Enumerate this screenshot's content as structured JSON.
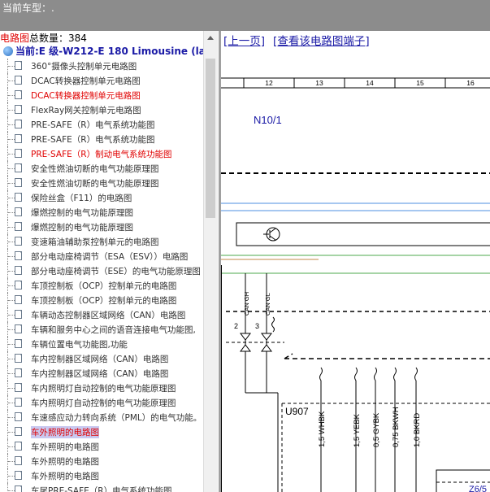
{
  "header": {
    "model_label": "当前车型：."
  },
  "sidebar": {
    "count_label": "电路图",
    "count_suffix": "总数量：384",
    "current_label": "当前:E 级-W212-E 180 Limousine (lan",
    "items": [
      {
        "label": "360°摄像头控制单元电路图",
        "state": "normal"
      },
      {
        "label": "DCAC转换器控制单元电路图",
        "state": "normal"
      },
      {
        "label": "DCAC转换器控制单元电路图",
        "state": "red"
      },
      {
        "label": "FlexRay网关控制单元电路图",
        "state": "normal"
      },
      {
        "label": "PRE-SAFE（R）电气系统功能图",
        "state": "normal"
      },
      {
        "label": "PRE-SAFE（R）电气系统功能图",
        "state": "normal"
      },
      {
        "label": "PRE-SAFE（R）制动电气系统功能图",
        "state": "red"
      },
      {
        "label": "安全性燃油切断的电气功能原理图",
        "state": "normal"
      },
      {
        "label": "安全性燃油切断的电气功能原理图",
        "state": "normal"
      },
      {
        "label": "保险丝盒（F11）的电路图",
        "state": "normal"
      },
      {
        "label": "爆燃控制的电气功能原理图",
        "state": "normal"
      },
      {
        "label": "爆燃控制的电气功能原理图",
        "state": "normal"
      },
      {
        "label": "变速箱油辅助泵控制单元的电路图",
        "state": "normal"
      },
      {
        "label": "部分电动座椅调节（ESA（ESV））电路图",
        "state": "normal"
      },
      {
        "label": "部分电动座椅调节（ESE）的电气功能原理图",
        "state": "normal"
      },
      {
        "label": "车顶控制板（OCP）控制单元的电路图",
        "state": "normal"
      },
      {
        "label": "车顶控制板（OCP）控制单元的电路图",
        "state": "normal"
      },
      {
        "label": "车辆动态控制器区域网络（CAN）电路图",
        "state": "normal"
      },
      {
        "label": "车辆和服务中心之间的语音连接电气功能图,",
        "state": "normal"
      },
      {
        "label": "车辆位置电气功能图,功能",
        "state": "normal"
      },
      {
        "label": "车内控制器区域网络（CAN）电路图",
        "state": "normal"
      },
      {
        "label": "车内控制器区域网络（CAN）电路图",
        "state": "normal"
      },
      {
        "label": "车内照明灯自动控制的电气功能原理图",
        "state": "normal"
      },
      {
        "label": "车内照明灯自动控制的电气功能原理图",
        "state": "normal"
      },
      {
        "label": "车速感应动力转向系统（PML）的电气功能。",
        "state": "normal"
      },
      {
        "label": "车外照明的电路图",
        "state": "selected"
      },
      {
        "label": "车外照明的电路图",
        "state": "normal"
      },
      {
        "label": "车外照明的电路图",
        "state": "normal"
      },
      {
        "label": "车外照明的电路图",
        "state": "normal"
      },
      {
        "label": "车尾PRE-SAFE（R）电气系统功能图",
        "state": "normal"
      }
    ]
  },
  "diagram": {
    "prev_link": "[上一页]",
    "view_pins_link": "[查看该电路图端子]",
    "grid_numbers": [
      "12",
      "13",
      "14",
      "15",
      "16"
    ],
    "component_label": "N10/1",
    "pin_labels": [
      "CAN GH",
      "CAN GL"
    ],
    "pin_numbers": [
      "2",
      "3"
    ],
    "connector_label": "U907",
    "wire_labels": [
      "1,5 WHBK",
      "1,5 YEBK",
      "0,5 GYBK",
      "0,75 BKWH",
      "1,0 BKRD"
    ],
    "corner_label": "Z6/5",
    "colors": {
      "link": "#1a1aa6",
      "red_item": "#e00000",
      "selected_bg": "#c9c9f0",
      "topbar": "#8c8c8c",
      "wire_blue": "#4c8fe0",
      "wire_green": "#4ca84c",
      "wire_brown": "#c08a4a"
    }
  }
}
